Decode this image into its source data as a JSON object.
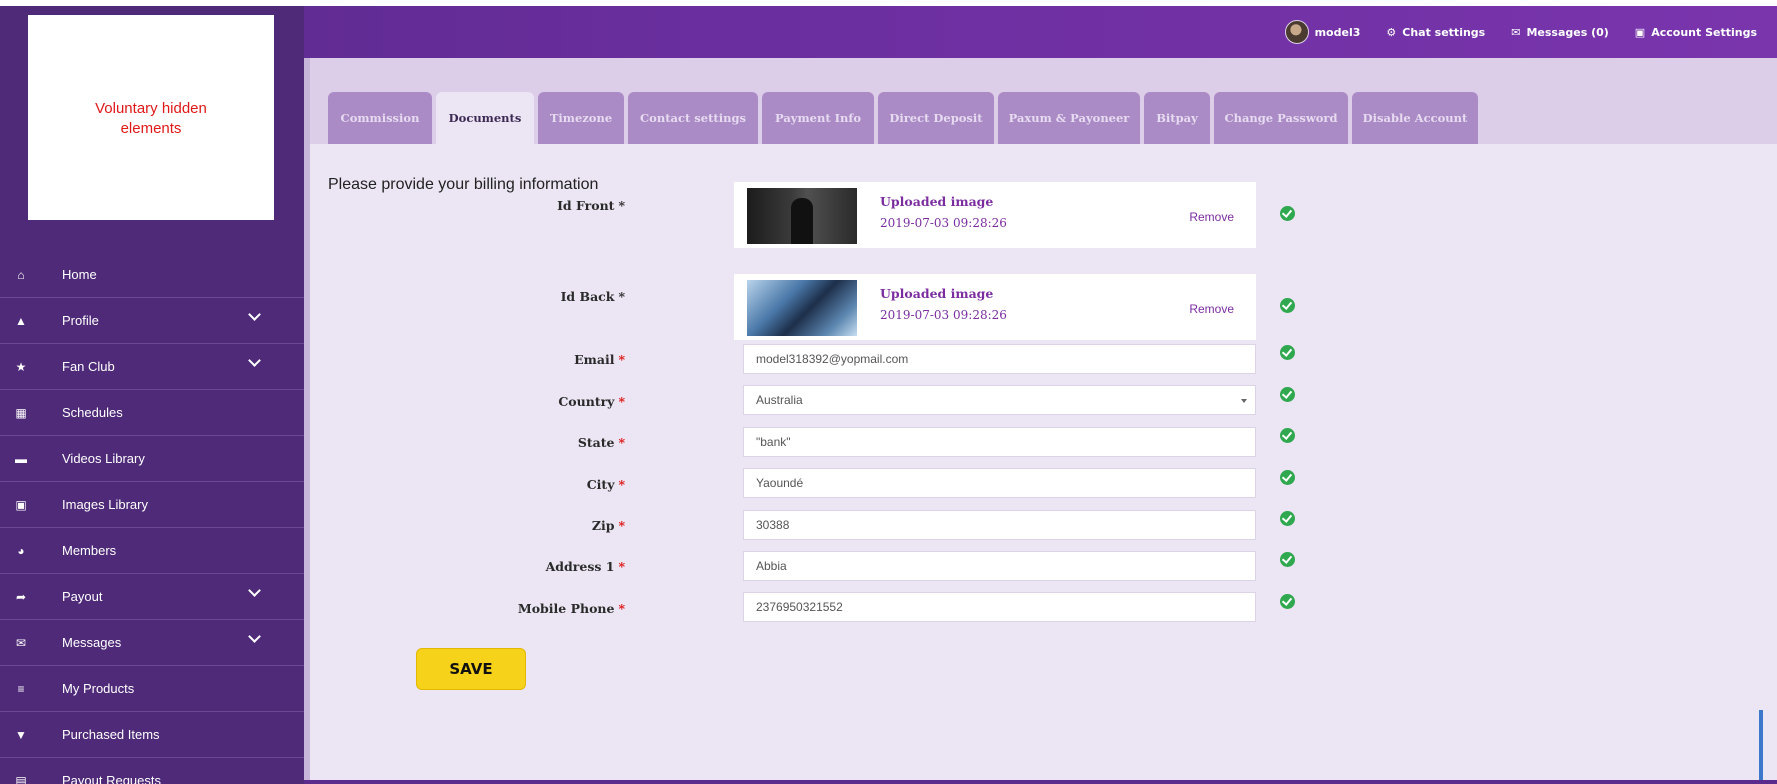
{
  "topbar": {
    "user": "model3",
    "chat_settings": "Chat settings",
    "messages": "Messages (0)",
    "account_settings": "Account Settings"
  },
  "placeholder_box": {
    "text": "Voluntary hidden elements"
  },
  "sidebar": {
    "items": [
      {
        "label": "Home",
        "icon": "home-icon",
        "glyph": "⌂",
        "has_submenu": false
      },
      {
        "label": "Profile",
        "icon": "user-icon",
        "glyph": "▲",
        "has_submenu": true
      },
      {
        "label": "Fan Club",
        "icon": "star-icon",
        "glyph": "★",
        "has_submenu": true
      },
      {
        "label": "Schedules",
        "icon": "calendar-icon",
        "glyph": "▦",
        "has_submenu": false
      },
      {
        "label": "Videos Library",
        "icon": "video-icon",
        "glyph": "▬",
        "has_submenu": false
      },
      {
        "label": "Images Library",
        "icon": "camera-icon",
        "glyph": "▣",
        "has_submenu": false
      },
      {
        "label": "Members",
        "icon": "members-icon",
        "glyph": "◕",
        "has_submenu": false
      },
      {
        "label": "Payout",
        "icon": "share-icon",
        "glyph": "➦",
        "has_submenu": true
      },
      {
        "label": "Messages",
        "icon": "envelope-icon",
        "glyph": "✉",
        "has_submenu": true
      },
      {
        "label": "My Products",
        "icon": "list-icon",
        "glyph": "≡",
        "has_submenu": false
      },
      {
        "label": "Purchased Items",
        "icon": "cart-icon",
        "glyph": "▼",
        "has_submenu": false
      },
      {
        "label": "Payout Requests",
        "icon": "money-icon",
        "glyph": "▤",
        "has_submenu": false
      }
    ]
  },
  "tabs": [
    {
      "label": "Commission",
      "active": false
    },
    {
      "label": "Documents",
      "active": true
    },
    {
      "label": "Timezone",
      "active": false
    },
    {
      "label": "Contact settings",
      "active": false
    },
    {
      "label": "Payment Info",
      "active": false
    },
    {
      "label": "Direct Deposit",
      "active": false
    },
    {
      "label": "Paxum & Payoneer",
      "active": false
    },
    {
      "label": "Bitpay",
      "active": false
    },
    {
      "label": "Change Password",
      "active": false
    },
    {
      "label": "Disable Account",
      "active": false
    }
  ],
  "form": {
    "title": "Please provide your billing information",
    "id_front": {
      "label": "Id Front",
      "status": "Uploaded image",
      "date": "2019-07-03 09:28:26",
      "remove": "Remove"
    },
    "id_back": {
      "label": "Id Back",
      "status": "Uploaded image",
      "date": "2019-07-03 09:28:26",
      "remove": "Remove"
    },
    "email": {
      "label": "Email",
      "value": "model318392@yopmail.com"
    },
    "country": {
      "label": "Country",
      "value": "Australia"
    },
    "state": {
      "label": "State",
      "value": "\"bank\""
    },
    "city": {
      "label": "City",
      "value": "Yaoundé"
    },
    "zip": {
      "label": "Zip",
      "value": "30388"
    },
    "address1": {
      "label": "Address 1",
      "value": "Abbia"
    },
    "mobile": {
      "label": "Mobile Phone",
      "value": "2376950321552"
    },
    "star": "*",
    "save_label": "SAVE"
  },
  "colors": {
    "brand_purple": "#5a2a8c",
    "tab_purple": "#ab8bc6",
    "accent_yellow": "#f7d21a",
    "ok_green": "#2fa84f",
    "required_red": "#dd1111"
  }
}
